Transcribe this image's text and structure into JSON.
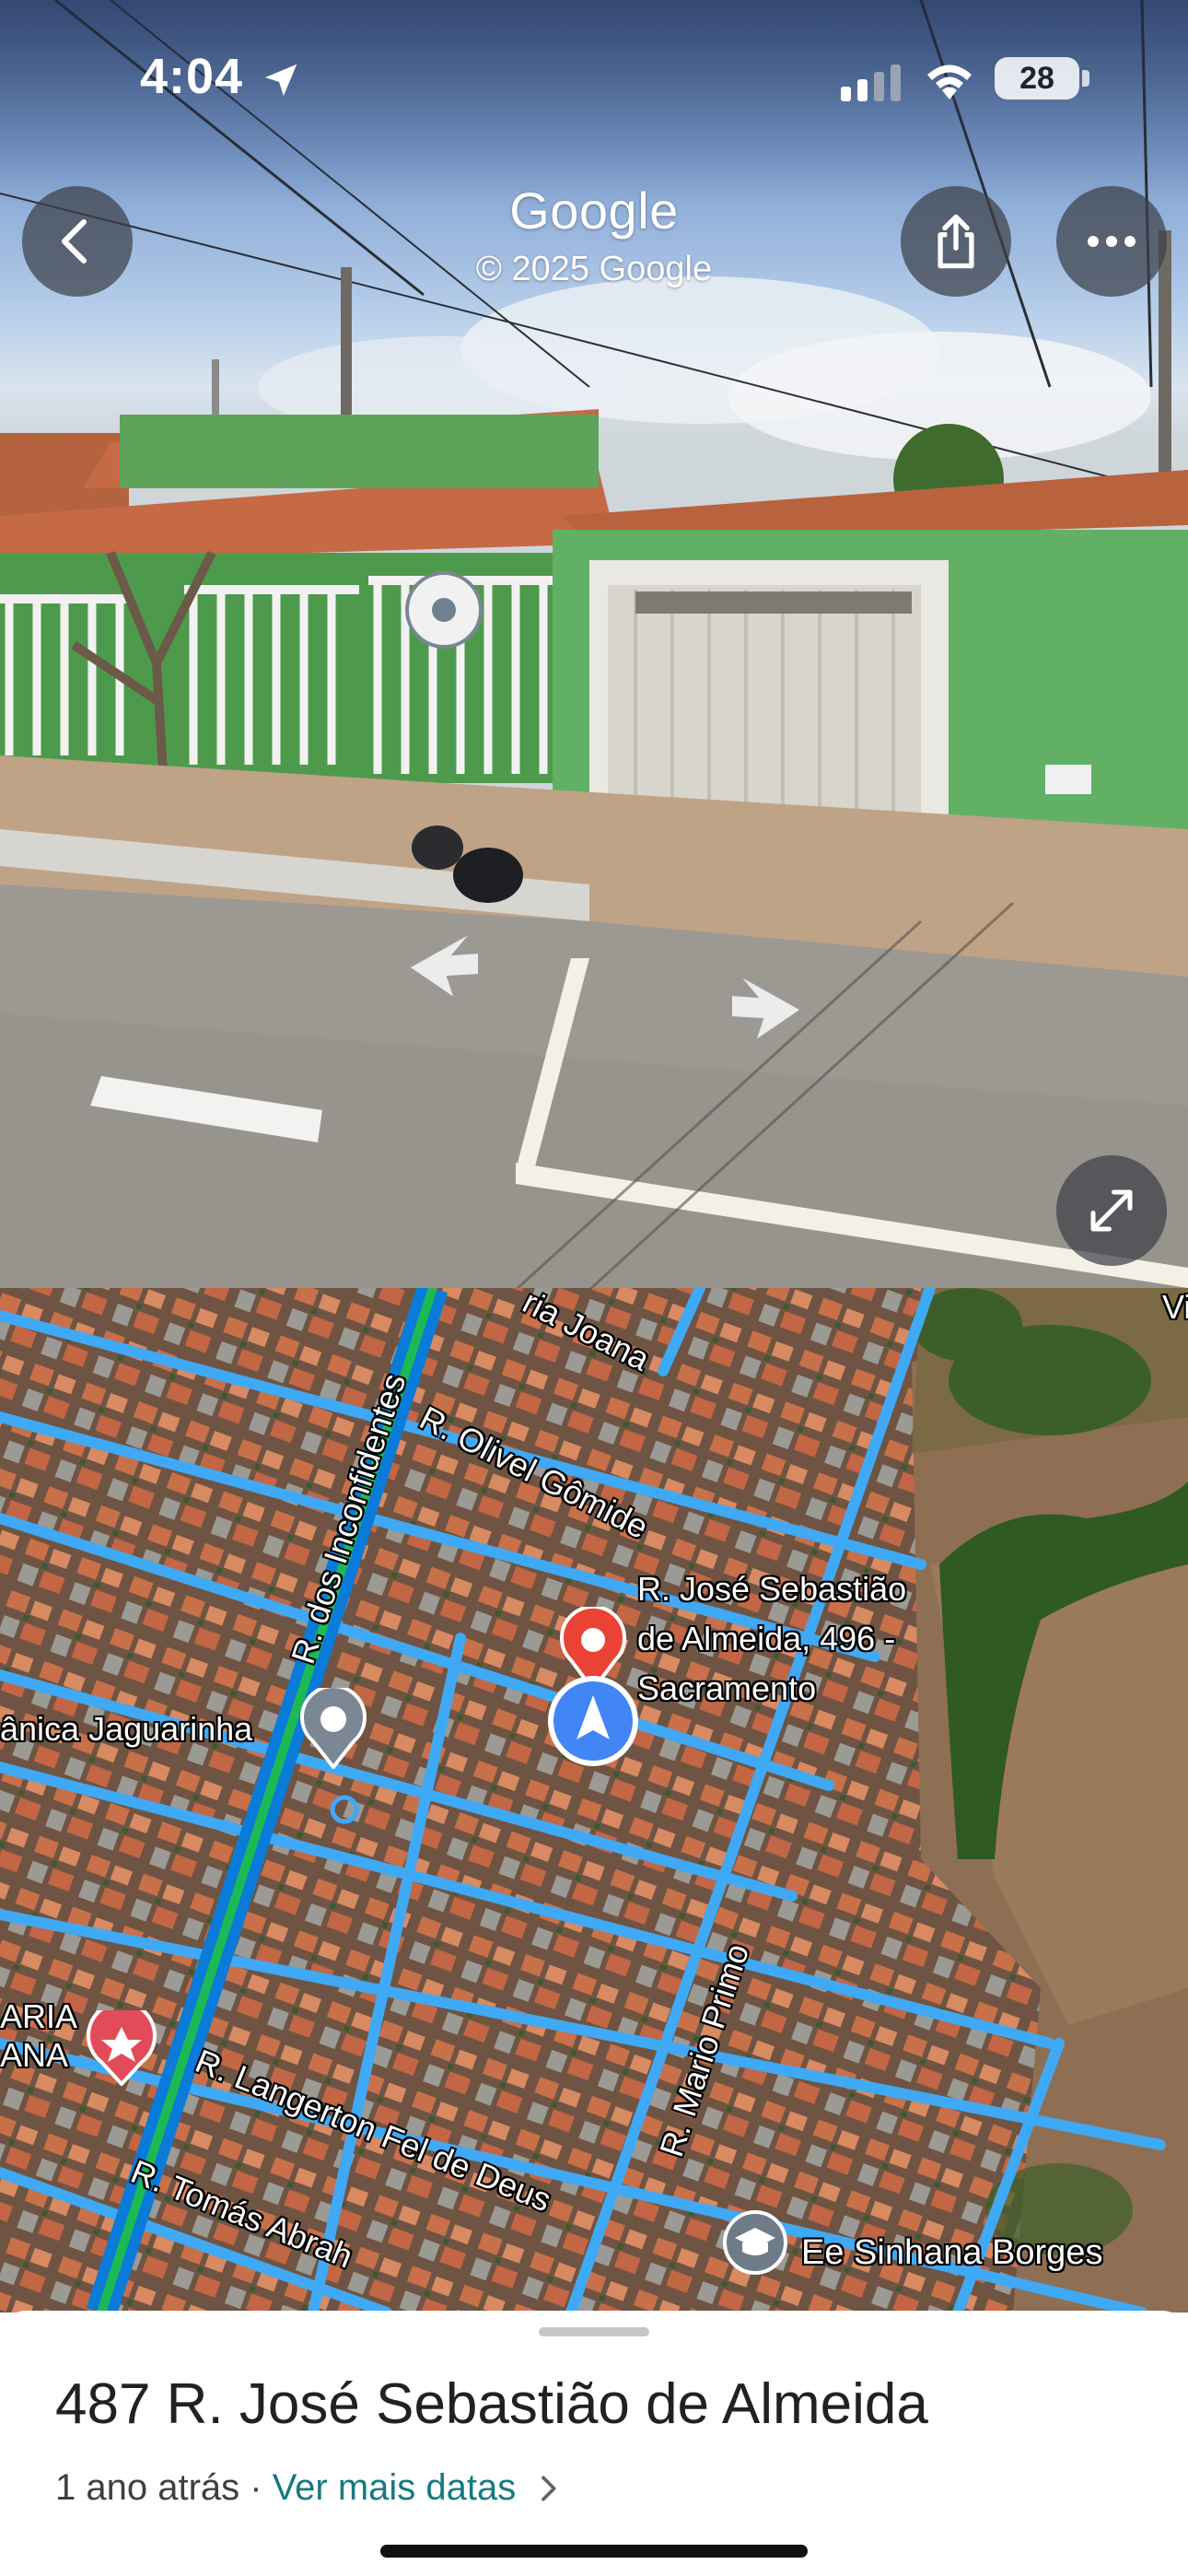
{
  "status_bar": {
    "time": "4:04",
    "battery": "28"
  },
  "street_view": {
    "title": "Google",
    "copyright": "© 2025 Google",
    "icons": {
      "back": "chevron-left-icon",
      "share": "share-icon",
      "more": "more-horizontal-icon",
      "expand": "expand-icon"
    }
  },
  "map": {
    "streets": [
      "R. dos Inconfidentes",
      "R. Olivel Gômide",
      "ria Joana",
      "R. Mario Primo",
      "R. Langerton Fel de Deus",
      "R. Tomás Abrah"
    ],
    "pin_label": [
      "R. José Sebastião",
      "de Almeida, 496 -",
      "Sacramento"
    ],
    "pois": {
      "jaguarinha": "ânica Jaguarinha",
      "left_partial": [
        "ARIA",
        "ANA"
      ],
      "school": "Ee Sinhana Borges",
      "top_right_partial": "Vi"
    },
    "colors": {
      "road": "#3fa9f5",
      "main_road": "#1db954",
      "pin_red": "#ea4335",
      "location_blue": "#4285f4"
    }
  },
  "sheet": {
    "address": "487 R. José Sebastião de Almeida",
    "time_ago": "1 ano atrás",
    "separator": " · ",
    "more_dates": "Ver mais datas"
  }
}
